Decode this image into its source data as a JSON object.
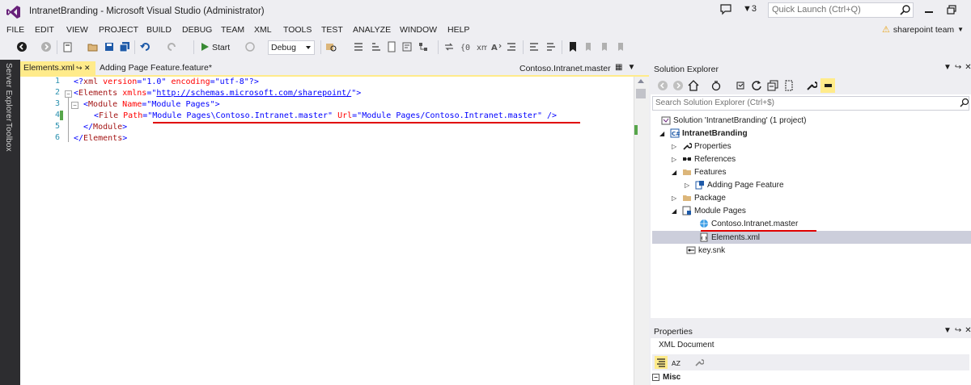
{
  "window": {
    "title": "IntranetBranding - Microsoft Visual Studio (Administrator)",
    "notification_count": "3",
    "quick_launch_placeholder": "Quick Launch (Ctrl+Q)"
  },
  "menu": [
    "FILE",
    "EDIT",
    "VIEW",
    "PROJECT",
    "BUILD",
    "DEBUG",
    "TEAM",
    "XML",
    "TOOLS",
    "TEST",
    "ANALYZE",
    "WINDOW",
    "HELP"
  ],
  "user": {
    "name": "sharepoint team"
  },
  "toolbar": {
    "start_label": "Start",
    "configuration": "Debug"
  },
  "side_tabs": [
    "Server Explorer",
    "Toolbox"
  ],
  "doc_tabs": {
    "active": "Elements.xml",
    "second": "Adding Page Feature.feature*",
    "right": "Contoso.Intranet.master"
  },
  "editor": {
    "line_numbers": [
      "1",
      "2",
      "3",
      "4",
      "5",
      "6"
    ],
    "lines": [
      {
        "p1": "<?",
        "t1": "xml",
        "a1": " version",
        "e1": "=\"",
        "v1": "1.0",
        "e2": "\" ",
        "a2": "encoding",
        "e3": "=\"",
        "v2": "utf-8",
        "e4": "\"",
        "p2": "?>"
      },
      {
        "p1": "<",
        "t1": "Elements",
        "a1": " xmlns",
        "e1": "=\"",
        "v1": "http://schemas.microsoft.com/sharepoint/",
        "e2": "\"",
        "p2": ">"
      },
      {
        "p1": "<",
        "t1": "Module",
        "a1": " Name",
        "e1": "=\"",
        "v1": "Module Pages",
        "e2": "\"",
        "p2": ">"
      },
      {
        "p1": "<",
        "t1": "File",
        "a1": " Path",
        "e1": "=\"",
        "v1": "Module Pages\\Contoso.Intranet.master",
        "e2": "\" ",
        "a2": "Url",
        "e3": "=\"",
        "v2": "Module Pages/Contoso.Intranet.master",
        "e4": "\" ",
        "p2": "/>"
      },
      {
        "p1": "</",
        "t1": "Module",
        "p2": ">"
      },
      {
        "p1": "</",
        "t1": "Elements",
        "p2": ">"
      }
    ]
  },
  "solution_explorer": {
    "title": "Solution Explorer",
    "search_placeholder": "Search Solution Explorer (Ctrl+$)",
    "tree": [
      "Solution 'IntranetBranding' (1 project)",
      "IntranetBranding",
      "Properties",
      "References",
      "Features",
      "Adding Page Feature",
      "Package",
      "Module Pages",
      "Contoso.Intranet.master",
      "Elements.xml",
      "key.snk"
    ]
  },
  "properties": {
    "title": "Properties",
    "object_type": "XML Document",
    "category": "Misc"
  },
  "colors": {
    "accent_tab": "#ffeb8b",
    "annotation_red": "#e00000",
    "selection": "#cccedb"
  }
}
